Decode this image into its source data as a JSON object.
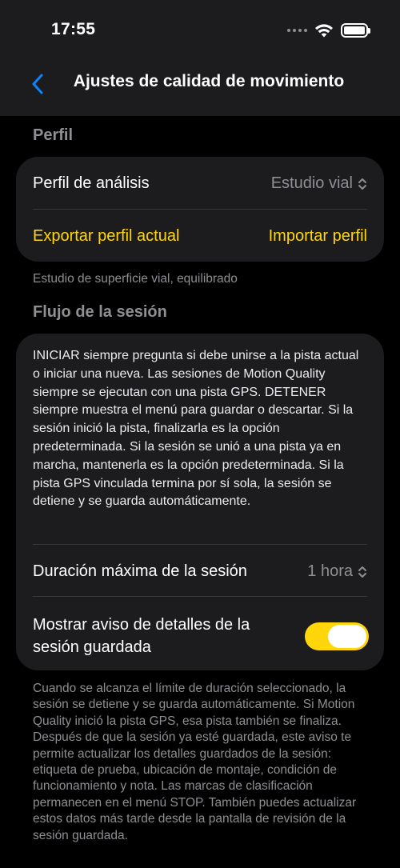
{
  "status_bar": {
    "time": "17:55"
  },
  "nav": {
    "title": "Ajustes de calidad de movimiento",
    "back_icon": "chevron-left-icon"
  },
  "profile_section": {
    "header": "Perfil",
    "analysis_profile_label": "Perfil de análisis",
    "analysis_profile_value": "Estudio vial",
    "export_label": "Exportar perfil actual",
    "import_label": "Importar perfil",
    "footnote": "Estudio de superficie vial, equilibrado"
  },
  "session_section": {
    "header": "Flujo de la sesión",
    "description": "INICIAR siempre pregunta si debe unirse a la pista actual o iniciar una nueva. Las sesiones de Motion Quality siempre se ejecutan con una pista GPS. DETENER siempre muestra el menú para guardar o descartar. Si la sesión inició la pista, finalizarla es la opción predeterminada. Si la sesión se unió a una pista ya en marcha, mantenerla es la opción predeterminada. Si la pista GPS vinculada termina por sí sola, la sesión se detiene y se guarda automáticamente.",
    "max_duration_label": "Duración máxima de la sesión",
    "max_duration_value": "1 hora",
    "show_notice_label": "Mostrar aviso de detalles de la sesión guardada",
    "show_notice_enabled": true,
    "footnote": "Cuando se alcanza el límite de duración seleccionado, la sesión se detiene y se guarda automáticamente. Si Motion Quality inició la pista GPS, esa pista también se finaliza. Después de que la sesión ya esté guardada, este aviso te permite actualizar los detalles guardados de la sesión: etiqueta de prueba, ubicación de montaje, condición de funcionamiento y nota. Las marcas de clasificación permanecen en el menú STOP. También puedes actualizar estos datos más tarde desde la pantalla de revisión de la sesión guardada."
  },
  "colors": {
    "accent": "#ffd60a",
    "link_blue": "#0a84ff",
    "card": "#1c1c1e",
    "secondary_text": "#8e8e93"
  }
}
